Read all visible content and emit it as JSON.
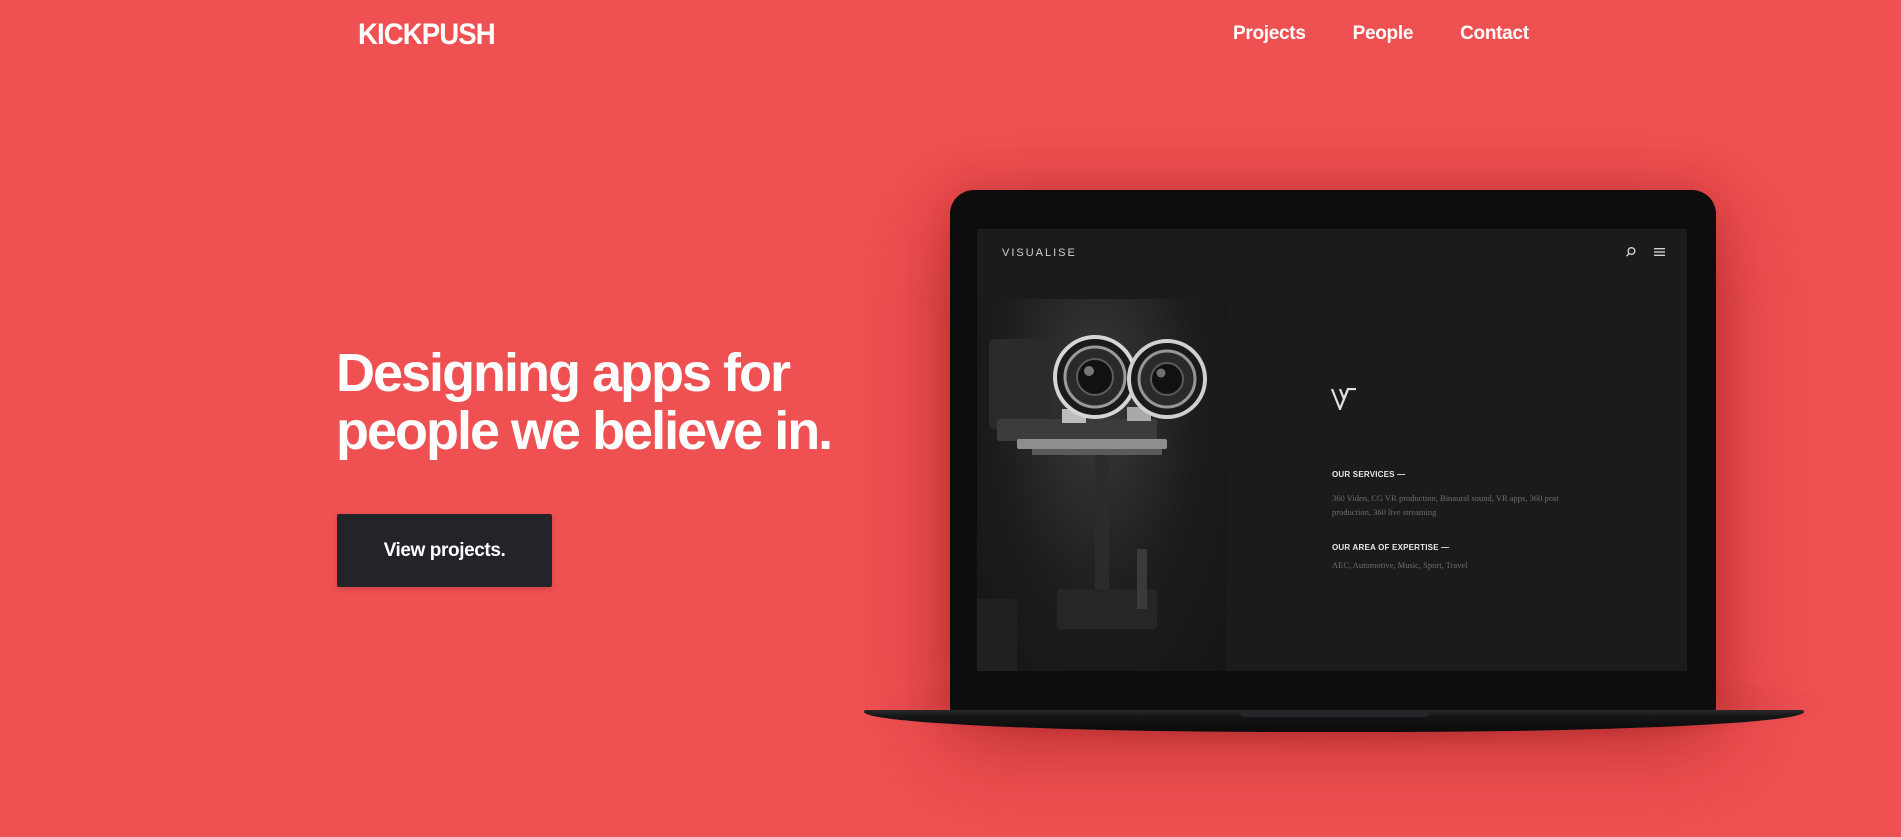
{
  "brand": {
    "logo": "KICKPUSH"
  },
  "nav": {
    "items": [
      {
        "label": "Projects"
      },
      {
        "label": "People"
      },
      {
        "label": "Contact"
      }
    ]
  },
  "hero": {
    "headline_line1": "Designing apps for",
    "headline_line2": "people we believe in.",
    "cta_label": "View projects."
  },
  "laptop_screen": {
    "brand": "VISUALISE",
    "services_title": "OUR SERVICES  —",
    "services_text": "360 Video, CG VR production, Binaural sound, VR apps, 360 post production, 360 live streaming",
    "expertise_title": "OUR AREA OF EXPERTISE  —",
    "expertise_text": "AEC, Automotive, Music, Sport, Travel"
  },
  "colors": {
    "background": "#ef5052",
    "button": "#23242a",
    "text": "#ffffff"
  },
  "icons": {
    "screen_search": "search-icon",
    "screen_menu": "hamburger-menu-icon",
    "screen_logo": "v-logo-icon"
  }
}
